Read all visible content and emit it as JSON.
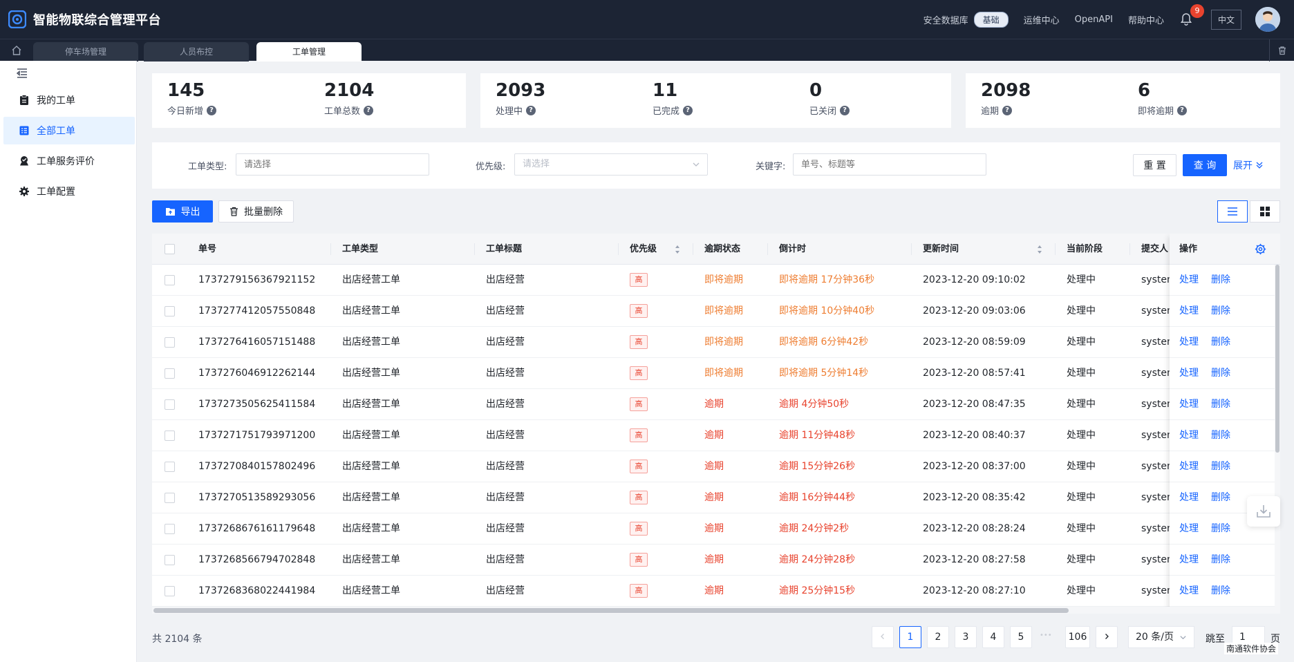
{
  "app": {
    "title": "智能物联综合管理平台"
  },
  "topnav": {
    "security_db": "安全数据库",
    "security_badge": "基础",
    "ops_center": "运维中心",
    "openapi": "OpenAPI",
    "help_center": "帮助中心",
    "notification_count": "9",
    "language": "中文"
  },
  "tabs": [
    {
      "label": "停车场管理"
    },
    {
      "label": "人员布控"
    },
    {
      "label": "工单管理"
    }
  ],
  "sidebar": {
    "items": [
      {
        "label": "我的工单",
        "icon": "clipboard-icon"
      },
      {
        "label": "全部工单",
        "icon": "list-icon"
      },
      {
        "label": "工单服务评价",
        "icon": "medal-icon"
      },
      {
        "label": "工单配置",
        "icon": "gear-icon"
      }
    ]
  },
  "stats": {
    "today_new": {
      "value": "145",
      "label": "今日新增"
    },
    "total": {
      "value": "2104",
      "label": "工单总数"
    },
    "processing": {
      "value": "2093",
      "label": "处理中"
    },
    "completed": {
      "value": "11",
      "label": "已完成"
    },
    "closed": {
      "value": "0",
      "label": "已关闭"
    },
    "overdue": {
      "value": "2098",
      "label": "逾期"
    },
    "due_soon": {
      "value": "6",
      "label": "即将逾期"
    }
  },
  "filters": {
    "type_label": "工单类型:",
    "type_placeholder": "请选择",
    "priority_label": "优先级:",
    "priority_placeholder": "请选择",
    "keyword_label": "关键字:",
    "keyword_placeholder": "单号、标题等",
    "reset": "重 置",
    "search": "查 询",
    "expand": "展开"
  },
  "toolbar": {
    "export": "导出",
    "batch_delete": "批量删除"
  },
  "table": {
    "columns": {
      "id": "单号",
      "type": "工单类型",
      "title": "工单标题",
      "priority": "优先级",
      "overdue_status": "逾期状态",
      "countdown": "倒计时",
      "updated": "更新时间",
      "stage": "当前阶段",
      "submitter": "提交人",
      "actions": "操作"
    },
    "action_process": "处理",
    "action_delete": "删除",
    "rows": [
      {
        "id": "1737279156367921152",
        "type": "出店经营工单",
        "title": "出店经营",
        "priority": "高",
        "status": "即将逾期",
        "countdown": "即将逾期 17分钟36秒",
        "updated": "2023-12-20 09:10:02",
        "stage": "处理中",
        "submitter": "system",
        "level": "warn"
      },
      {
        "id": "1737277412057550848",
        "type": "出店经营工单",
        "title": "出店经营",
        "priority": "高",
        "status": "即将逾期",
        "countdown": "即将逾期 10分钟40秒",
        "updated": "2023-12-20 09:03:06",
        "stage": "处理中",
        "submitter": "system",
        "level": "warn"
      },
      {
        "id": "1737276416057151488",
        "type": "出店经营工单",
        "title": "出店经营",
        "priority": "高",
        "status": "即将逾期",
        "countdown": "即将逾期 6分钟42秒",
        "updated": "2023-12-20 08:59:09",
        "stage": "处理中",
        "submitter": "system",
        "level": "warn"
      },
      {
        "id": "1737276046912262144",
        "type": "出店经营工单",
        "title": "出店经营",
        "priority": "高",
        "status": "即将逾期",
        "countdown": "即将逾期 5分钟14秒",
        "updated": "2023-12-20 08:57:41",
        "stage": "处理中",
        "submitter": "system",
        "level": "warn"
      },
      {
        "id": "1737273505625411584",
        "type": "出店经营工单",
        "title": "出店经营",
        "priority": "高",
        "status": "逾期",
        "countdown": "逾期 4分钟50秒",
        "updated": "2023-12-20 08:47:35",
        "stage": "处理中",
        "submitter": "system",
        "level": "over"
      },
      {
        "id": "1737271751793971200",
        "type": "出店经营工单",
        "title": "出店经营",
        "priority": "高",
        "status": "逾期",
        "countdown": "逾期 11分钟48秒",
        "updated": "2023-12-20 08:40:37",
        "stage": "处理中",
        "submitter": "system",
        "level": "over"
      },
      {
        "id": "1737270840157802496",
        "type": "出店经营工单",
        "title": "出店经营",
        "priority": "高",
        "status": "逾期",
        "countdown": "逾期 15分钟26秒",
        "updated": "2023-12-20 08:37:00",
        "stage": "处理中",
        "submitter": "system",
        "level": "over"
      },
      {
        "id": "1737270513589293056",
        "type": "出店经营工单",
        "title": "出店经营",
        "priority": "高",
        "status": "逾期",
        "countdown": "逾期 16分钟44秒",
        "updated": "2023-12-20 08:35:42",
        "stage": "处理中",
        "submitter": "system",
        "level": "over"
      },
      {
        "id": "1737268676161179648",
        "type": "出店经营工单",
        "title": "出店经营",
        "priority": "高",
        "status": "逾期",
        "countdown": "逾期 24分钟2秒",
        "updated": "2023-12-20 08:28:24",
        "stage": "处理中",
        "submitter": "system",
        "level": "over"
      },
      {
        "id": "1737268566794702848",
        "type": "出店经营工单",
        "title": "出店经营",
        "priority": "高",
        "status": "逾期",
        "countdown": "逾期 24分钟28秒",
        "updated": "2023-12-20 08:27:58",
        "stage": "处理中",
        "submitter": "system",
        "level": "over"
      },
      {
        "id": "1737268368022441984",
        "type": "出店经营工单",
        "title": "出店经营",
        "priority": "高",
        "status": "逾期",
        "countdown": "逾期 25分钟15秒",
        "updated": "2023-12-20 08:27:10",
        "stage": "处理中",
        "submitter": "system",
        "level": "over"
      }
    ]
  },
  "pagination": {
    "total_text": "共 2104 条",
    "pages": [
      "1",
      "2",
      "3",
      "4",
      "5"
    ],
    "ellipsis": "•••",
    "last_page": "106",
    "current_page": "1",
    "page_size": "20 条/页",
    "jump_label": "跳至",
    "jump_value": "1",
    "page_suffix": "页"
  },
  "watermark": "南通软件协会",
  "colors": {
    "primary": "#1664ff",
    "warn": "#ee7d31",
    "danger": "#e8432e",
    "topbar": "#1c2434"
  }
}
